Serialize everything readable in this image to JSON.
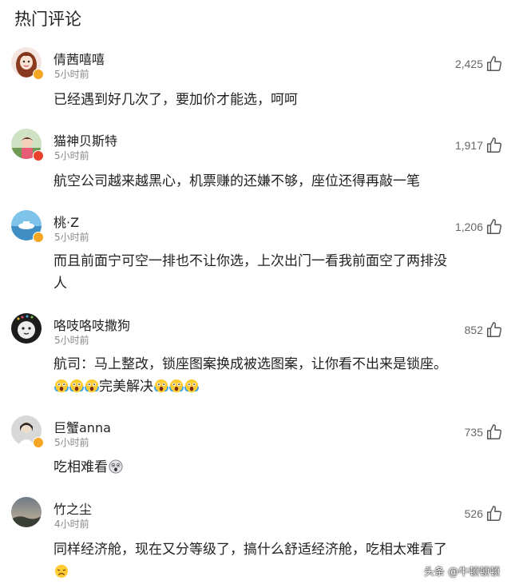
{
  "header": {
    "title": "热门评论"
  },
  "colors": {
    "verified_badge": "#f5a623",
    "like_count": "#666666",
    "time": "#888888"
  },
  "comments": [
    {
      "user": "倩茜嘻嘻",
      "time": "5小时前",
      "likes": "2,425",
      "line1": "已经遇到好几次了，要加价才能选，呵呵",
      "line2": "",
      "emoji_text": "",
      "verified": true
    },
    {
      "user": "猫神贝斯特",
      "time": "5小时前",
      "likes": "1,917",
      "line1": "航空公司越来越黑心，机票赚的还嫌不够，座位还得再敲一笔",
      "line2": "",
      "emoji_text": "",
      "verified": true
    },
    {
      "user": "桃·Z",
      "time": "5小时前",
      "likes": "1,206",
      "line1": "而且前面宁可空一排也不让你选，上次出门一看我前面空了两排没",
      "line2": "人",
      "emoji_text": "",
      "verified": true
    },
    {
      "user": "咯吱咯吱撒狗",
      "time": "5小时前",
      "likes": "852",
      "line1": "航司：马上整改，锁座图案换成被选图案，让你看不出来是锁座。",
      "line2": "",
      "emoji_text": "完美解决",
      "verified": false
    },
    {
      "user": "巨蟹anna",
      "time": "5小时前",
      "likes": "735",
      "line1": "吃相难看",
      "line2": "",
      "emoji_text": "",
      "verified": true
    },
    {
      "user": "竹之尘",
      "time": "4小时前",
      "likes": "526",
      "line1": "同样经济舱，现在又分等级了，搞什么舒适经济舱，吃相太难看了",
      "line2": "",
      "emoji_text": "",
      "verified": false
    }
  ],
  "icons": {
    "like": "thumbs-up-icon",
    "verified": "verified-badge-icon",
    "emoji_scream": "scream-face-emoji",
    "emoji_shock": "shocked-face-emoji",
    "emoji_sad": "weary-face-emoji"
  },
  "watermark": "头条 @牛顿顿顿"
}
